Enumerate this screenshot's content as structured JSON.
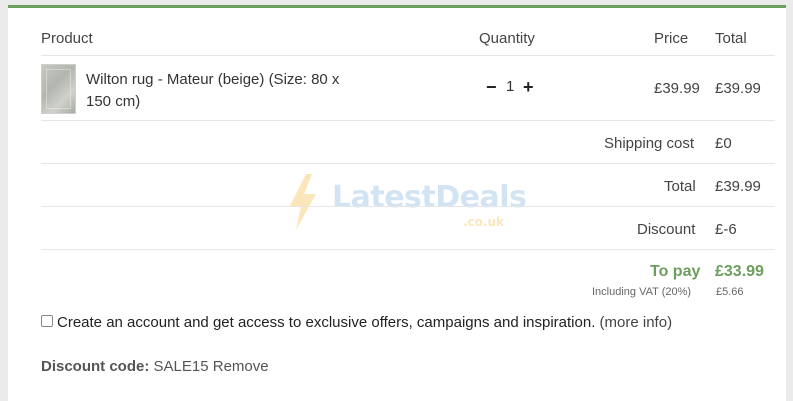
{
  "table": {
    "headers": {
      "product": "Product",
      "quantity": "Quantity",
      "price": "Price",
      "total": "Total"
    },
    "item": {
      "name": "Wilton rug - Mateur (beige) (Size: 80 x 150 cm)",
      "quantity": "1",
      "price": "£39.99",
      "total": "£39.99"
    }
  },
  "summary": {
    "shipping_label": "Shipping cost",
    "shipping_value": "£0",
    "total_label": "Total",
    "total_value": "£39.99",
    "discount_label": "Discount",
    "discount_value": "£-6",
    "to_pay_label": "To pay",
    "to_pay_value": "£33.99",
    "vat_label": "Including VAT (20%)",
    "vat_value": "£5.66"
  },
  "account": {
    "checkbox_label": "Create an account and get access to exclusive offers, campaigns and inspiration.",
    "more_info": "(more info)"
  },
  "discount_code": {
    "label": "Discount code:",
    "code": "SALE15",
    "remove": "Remove"
  },
  "watermark": {
    "brand": "LatestDeals",
    "domain": ".co.uk"
  },
  "colors": {
    "accent_green": "#6c9e5d",
    "watermark_blue": "#7fb3e0",
    "watermark_orange": "#f4b63f"
  },
  "icons": {
    "decrease": "minus-icon",
    "increase": "plus-icon",
    "watermark": "lightning-bolt-icon"
  }
}
